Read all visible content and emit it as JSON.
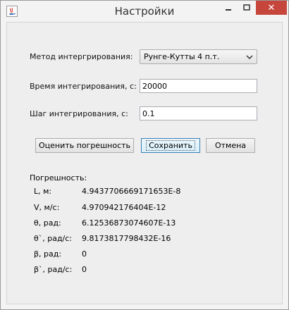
{
  "window": {
    "title": "Настройки",
    "close_glyph": "✕",
    "icon": "java-app-icon"
  },
  "form": {
    "method_label": "Метод интергрирования:",
    "method_value": "Рунге-Кутты 4 п.т.",
    "time_label": "Время интегрирования, с:",
    "time_value": "20000",
    "step_label": "Шаг интегрирования, с:",
    "step_value": "0.1"
  },
  "buttons": {
    "estimate": "Оценить погрешность",
    "save": "Сохранить",
    "cancel": "Отмена"
  },
  "errors": {
    "title": "Погрешность:",
    "rows": [
      {
        "name": "L, м:",
        "value": "4.9437706669171653E-8"
      },
      {
        "name": "V, м/с:",
        "value": "4.970942176404E-12"
      },
      {
        "name": "θ, рад:",
        "value": "6.12536873074607E-13"
      },
      {
        "name": "θ`, рад/с:",
        "value": "9.8173817798432E-16"
      },
      {
        "name": "β, рад:",
        "value": "0"
      },
      {
        "name": "β`, рад/с:",
        "value": "0"
      }
    ]
  }
}
